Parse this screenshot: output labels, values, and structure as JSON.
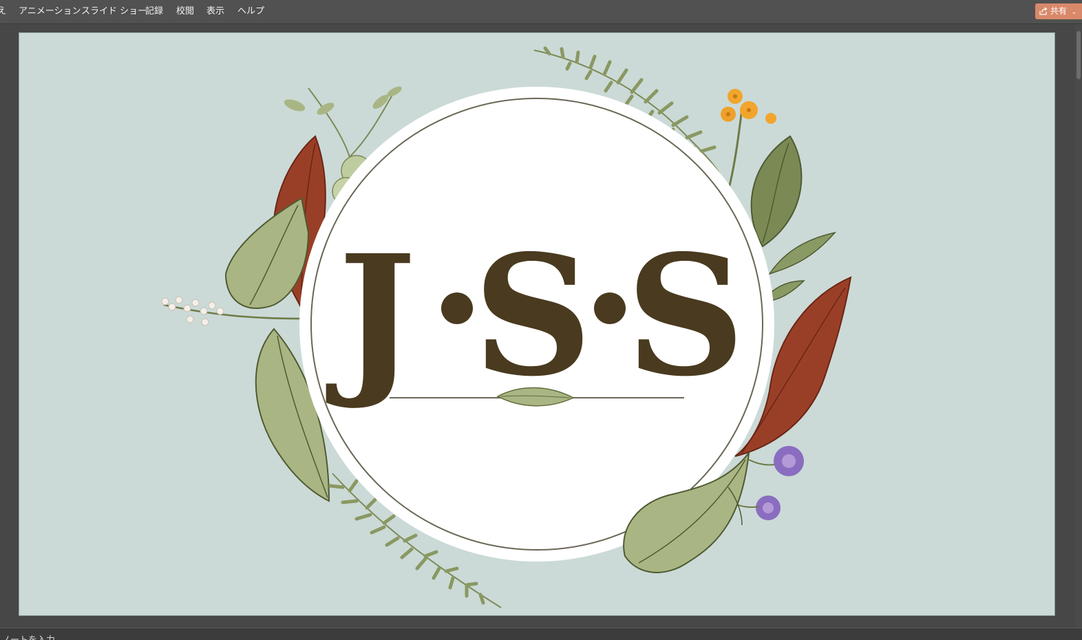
{
  "menu": {
    "items": [
      {
        "label": "え"
      },
      {
        "label": "アニメーション"
      },
      {
        "label": "スライド ショー"
      },
      {
        "label": "記録"
      },
      {
        "label": "校閲"
      },
      {
        "label": "表示"
      },
      {
        "label": "ヘルプ"
      }
    ],
    "share_label": "共有"
  },
  "slide": {
    "background_color": "#cbdad7",
    "monogram": {
      "letters": [
        "J",
        "S",
        "S"
      ],
      "text_color": "#4a3a1f"
    }
  },
  "notes": {
    "placeholder": "ノートを入力"
  }
}
